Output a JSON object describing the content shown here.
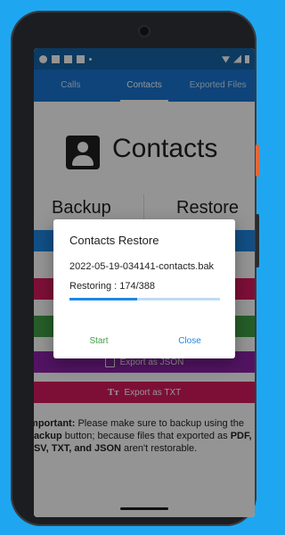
{
  "tabs": [
    {
      "label": "Calls"
    },
    {
      "label": "Contacts"
    },
    {
      "label": "Exported Files"
    }
  ],
  "header": {
    "title": "Contacts"
  },
  "sections": {
    "backup": "Backup",
    "restore": "Restore"
  },
  "exports": {
    "json": "Export as JSON",
    "txt": "Export as TXT"
  },
  "note": {
    "important_label": "Important:",
    "text1": " Please make sure to backup using the ",
    "backup_word": "Backup",
    "text2": " button; because files that exported as ",
    "formats": "PDF, CSV, TXT, and JSON",
    "text3": " aren't restorable."
  },
  "dialog": {
    "title": "Contacts Restore",
    "filename": "2022-05-19-034141-contacts.bak",
    "progress_text": "Restoring : 174/388",
    "progress_fraction": 0.448,
    "start_label": "Start",
    "close_label": "Close"
  },
  "colors": {
    "background": "#1ea7f0",
    "tab_bar": "#1976d2",
    "accent": "#1e88e5"
  },
  "status_icons": [
    "settings-icon",
    "gmail-icon",
    "trash-icon",
    "sd-card-icon",
    "wifi-icon",
    "signal-icon",
    "battery-icon"
  ]
}
